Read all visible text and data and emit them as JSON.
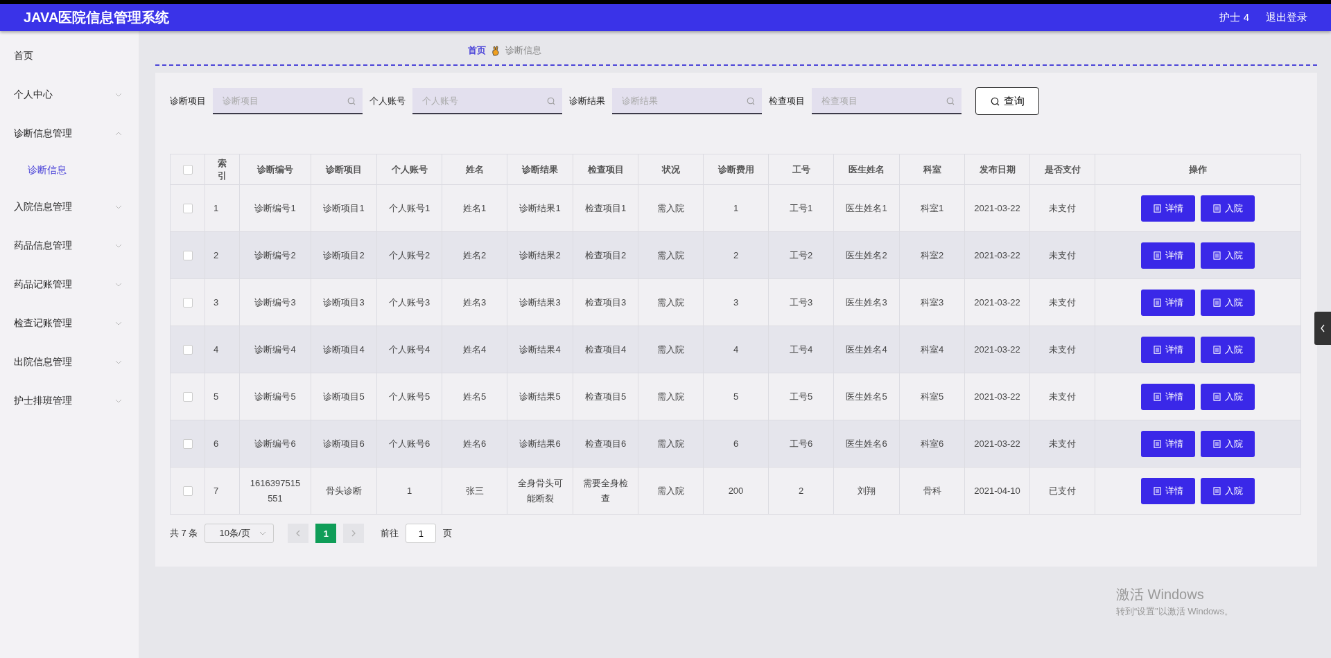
{
  "header": {
    "title": "JAVA医院信息管理系统",
    "user": "护士 4",
    "logout": "退出登录"
  },
  "sidebar": {
    "items": [
      {
        "label": "首页"
      },
      {
        "label": "个人中心",
        "expanded": false
      },
      {
        "label": "诊断信息管理",
        "expanded": true,
        "children": [
          {
            "label": "诊断信息",
            "selected": true
          }
        ]
      },
      {
        "label": "入院信息管理",
        "expanded": false
      },
      {
        "label": "药品信息管理",
        "expanded": false
      },
      {
        "label": "药品记账管理",
        "expanded": false
      },
      {
        "label": "检查记账管理",
        "expanded": false
      },
      {
        "label": "出院信息管理",
        "expanded": false
      },
      {
        "label": "护士排班管理",
        "expanded": false
      }
    ]
  },
  "breadcrumb": {
    "home": "首页",
    "current": "诊断信息"
  },
  "search": {
    "fields": [
      {
        "label": "诊断项目",
        "placeholder": "诊断项目"
      },
      {
        "label": "个人账号",
        "placeholder": "个人账号"
      },
      {
        "label": "诊断结果",
        "placeholder": "诊断结果"
      },
      {
        "label": "检查项目",
        "placeholder": "检查项目"
      }
    ],
    "button": "查询"
  },
  "table": {
    "select_all": {
      "checked": false
    },
    "columns": [
      "索引",
      "诊断编号",
      "诊断项目",
      "个人账号",
      "姓名",
      "诊断结果",
      "检查项目",
      "状况",
      "诊断费用",
      "工号",
      "医生姓名",
      "科室",
      "发布日期",
      "是否支付",
      "操作"
    ],
    "rows": [
      {
        "checked": false,
        "cells": [
          "1",
          "诊断编号1",
          "诊断项目1",
          "个人账号1",
          "姓名1",
          "诊断结果1",
          "检查项目1",
          "需入院",
          "1",
          "工号1",
          "医生姓名1",
          "科室1",
          "2021-03-22",
          "未支付"
        ],
        "actions": [
          "详情",
          "入院"
        ]
      },
      {
        "checked": false,
        "cells": [
          "2",
          "诊断编号2",
          "诊断项目2",
          "个人账号2",
          "姓名2",
          "诊断结果2",
          "检查项目2",
          "需入院",
          "2",
          "工号2",
          "医生姓名2",
          "科室2",
          "2021-03-22",
          "未支付"
        ],
        "actions": [
          "详情",
          "入院"
        ]
      },
      {
        "checked": false,
        "cells": [
          "3",
          "诊断编号3",
          "诊断项目3",
          "个人账号3",
          "姓名3",
          "诊断结果3",
          "检查项目3",
          "需入院",
          "3",
          "工号3",
          "医生姓名3",
          "科室3",
          "2021-03-22",
          "未支付"
        ],
        "actions": [
          "详情",
          "入院"
        ]
      },
      {
        "checked": false,
        "cells": [
          "4",
          "诊断编号4",
          "诊断项目4",
          "个人账号4",
          "姓名4",
          "诊断结果4",
          "检查项目4",
          "需入院",
          "4",
          "工号4",
          "医生姓名4",
          "科室4",
          "2021-03-22",
          "未支付"
        ],
        "actions": [
          "详情",
          "入院"
        ]
      },
      {
        "checked": false,
        "cells": [
          "5",
          "诊断编号5",
          "诊断项目5",
          "个人账号5",
          "姓名5",
          "诊断结果5",
          "检查项目5",
          "需入院",
          "5",
          "工号5",
          "医生姓名5",
          "科室5",
          "2021-03-22",
          "未支付"
        ],
        "actions": [
          "详情",
          "入院"
        ]
      },
      {
        "checked": false,
        "cells": [
          "6",
          "诊断编号6",
          "诊断项目6",
          "个人账号6",
          "姓名6",
          "诊断结果6",
          "检查项目6",
          "需入院",
          "6",
          "工号6",
          "医生姓名6",
          "科室6",
          "2021-03-22",
          "未支付"
        ],
        "actions": [
          "详情",
          "入院"
        ]
      },
      {
        "checked": false,
        "cells": [
          "7",
          "1616397515551",
          "骨头诊断",
          "1",
          "张三",
          "全身骨头可能断裂",
          "需要全身检查",
          "需入院",
          "200",
          "2",
          "刘翔",
          "骨科",
          "2021-04-10",
          "已支付"
        ],
        "actions": [
          "详情",
          "入院"
        ]
      }
    ]
  },
  "pagination": {
    "total": "共 7 条",
    "page_size": "10条/页",
    "pages": [
      {
        "label": "1",
        "selected": true
      }
    ],
    "goto": "前往",
    "goto_value": "1",
    "goto_suffix": "页"
  },
  "activation_notice": {
    "title": "激活 Windows",
    "text": "转到“设置”以激活 Windows。"
  }
}
